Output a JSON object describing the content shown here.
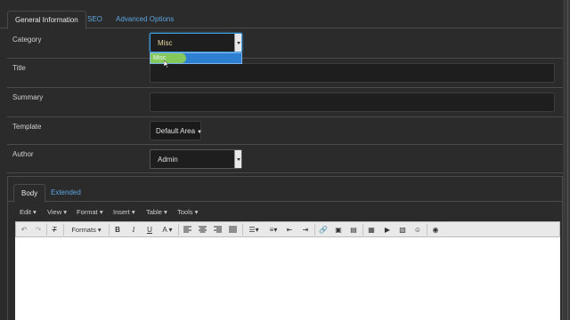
{
  "tabs": [
    "General Information",
    "SEO",
    "Advanced Options"
  ],
  "fields": {
    "category_label": "Category",
    "category_value": "Misc",
    "category_option": "Misc",
    "title_label": "Title",
    "summary_label": "Summary",
    "template_label": "Template",
    "template_value": "Default Area",
    "author_label": "Author",
    "author_value": "Admin"
  },
  "editor": {
    "tabs": [
      "Body",
      "Extended"
    ],
    "menus": [
      "Edit",
      "View",
      "Format",
      "Insert",
      "Table",
      "Tools"
    ],
    "formats_label": "Formats"
  },
  "colors": {
    "accent": "#5ba3e0",
    "background": "#2b2b2b",
    "selection": "#2d7fd2",
    "highlight": "#8fd14f"
  }
}
